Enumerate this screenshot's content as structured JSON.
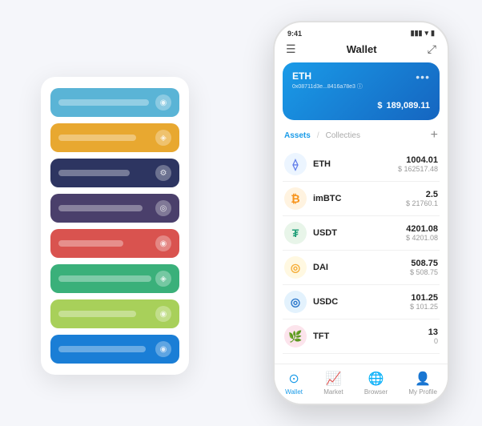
{
  "scene": {
    "background": "#f5f6fa"
  },
  "cardStack": {
    "items": [
      {
        "color": "#5ab4d6",
        "barWidth": "70%",
        "iconChar": "◉"
      },
      {
        "color": "#e8a830",
        "barWidth": "60%",
        "iconChar": "◈"
      },
      {
        "color": "#2d3561",
        "barWidth": "55%",
        "iconChar": "⚙"
      },
      {
        "color": "#4a3f6b",
        "barWidth": "65%",
        "iconChar": "◎"
      },
      {
        "color": "#d9534f",
        "barWidth": "50%",
        "iconChar": "◉"
      },
      {
        "color": "#3ab07a",
        "barWidth": "72%",
        "iconChar": "◈"
      },
      {
        "color": "#a8d05a",
        "barWidth": "60%",
        "iconChar": "◉"
      },
      {
        "color": "#1a7ed6",
        "barWidth": "68%",
        "iconChar": "◉"
      }
    ]
  },
  "phone": {
    "statusBar": {
      "time": "9:41",
      "icons": "▮▮▮ ▾ ▮"
    },
    "header": {
      "menuIcon": "☰",
      "title": "Wallet",
      "expandIcon": "⤢"
    },
    "ethCard": {
      "title": "ETH",
      "address": "0x08711d3e...8416a78e3 ⓘ",
      "moreIcon": "•••",
      "currencySymbol": "$",
      "amount": "189,089.11"
    },
    "assetsSection": {
      "activeTab": "Assets",
      "divider": "/",
      "inactiveTab": "Collecties",
      "addIcon": "+"
    },
    "assets": [
      {
        "symbol": "ETH",
        "iconBg": "#ecf5ff",
        "iconColor": "#627eea",
        "iconChar": "⟠",
        "amount": "1004.01",
        "usd": "$ 162517.48"
      },
      {
        "symbol": "imBTC",
        "iconBg": "#fff3e0",
        "iconColor": "#f7931a",
        "iconChar": "₿",
        "amount": "2.5",
        "usd": "$ 21760.1"
      },
      {
        "symbol": "USDT",
        "iconBg": "#e8f5e9",
        "iconColor": "#26a17b",
        "iconChar": "₮",
        "amount": "4201.08",
        "usd": "$ 4201.08"
      },
      {
        "symbol": "DAI",
        "iconBg": "#fff8e1",
        "iconColor": "#f5ac37",
        "iconChar": "◎",
        "amount": "508.75",
        "usd": "$ 508.75"
      },
      {
        "symbol": "USDC",
        "iconBg": "#e3f2fd",
        "iconColor": "#2775ca",
        "iconChar": "◎",
        "amount": "101.25",
        "usd": "$ 101.25"
      },
      {
        "symbol": "TFT",
        "iconBg": "#fce4ec",
        "iconColor": "#e91e8c",
        "iconChar": "🌿",
        "amount": "13",
        "usd": "0"
      }
    ],
    "bottomNav": [
      {
        "icon": "⊙",
        "label": "Wallet",
        "active": true
      },
      {
        "icon": "📈",
        "label": "Market",
        "active": false
      },
      {
        "icon": "🌐",
        "label": "Browser",
        "active": false
      },
      {
        "icon": "👤",
        "label": "My Profile",
        "active": false
      }
    ]
  }
}
